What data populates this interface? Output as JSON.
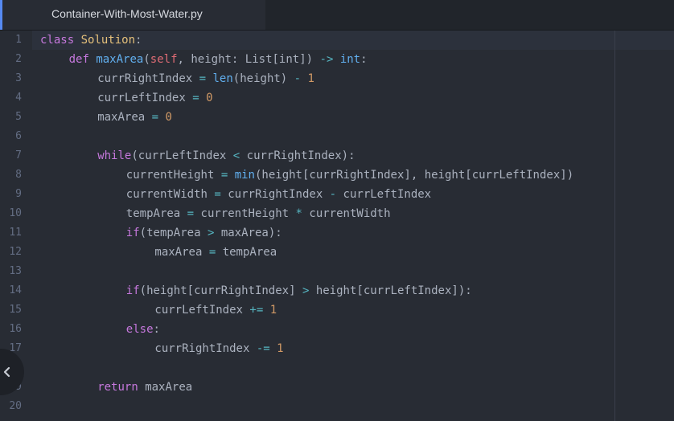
{
  "tab": {
    "title": "Container-With-Most-Water.py"
  },
  "colors": {
    "background": "#282c34",
    "keyword": "#c678dd",
    "function": "#61afef",
    "class": "#e5c07b",
    "number": "#d19a66",
    "operator": "#56b6c2",
    "self": "#e06c75",
    "plain": "#abb2bf",
    "line_number": "#636d83",
    "tab_accent": "#568af2"
  },
  "nav": {
    "icon": "chevron-left-icon"
  },
  "line_numbers": [
    "1",
    "2",
    "3",
    "4",
    "5",
    "6",
    "7",
    "8",
    "9",
    "10",
    "11",
    "12",
    "13",
    "14",
    "15",
    "16",
    "17",
    "",
    "19",
    "20"
  ],
  "code_lines": [
    {
      "num": "1",
      "indent": 0,
      "tokens": [
        {
          "t": "class",
          "c": "keyword"
        },
        {
          "t": " ",
          "c": "plain"
        },
        {
          "t": "Solution",
          "c": "class"
        },
        {
          "t": ":",
          "c": "plain"
        }
      ]
    },
    {
      "num": "2",
      "indent": 1,
      "tokens": [
        {
          "t": "def",
          "c": "keyword"
        },
        {
          "t": " ",
          "c": "plain"
        },
        {
          "t": "maxArea",
          "c": "function"
        },
        {
          "t": "(",
          "c": "plain"
        },
        {
          "t": "self",
          "c": "self"
        },
        {
          "t": ", height: List[int]) ",
          "c": "plain"
        },
        {
          "t": "->",
          "c": "operator"
        },
        {
          "t": " ",
          "c": "plain"
        },
        {
          "t": "int",
          "c": "function"
        },
        {
          "t": ":",
          "c": "plain"
        }
      ]
    },
    {
      "num": "3",
      "indent": 2,
      "tokens": [
        {
          "t": "currRightIndex ",
          "c": "plain"
        },
        {
          "t": "=",
          "c": "operator"
        },
        {
          "t": " ",
          "c": "plain"
        },
        {
          "t": "len",
          "c": "function"
        },
        {
          "t": "(height) ",
          "c": "plain"
        },
        {
          "t": "-",
          "c": "operator"
        },
        {
          "t": " ",
          "c": "plain"
        },
        {
          "t": "1",
          "c": "number"
        }
      ]
    },
    {
      "num": "4",
      "indent": 2,
      "tokens": [
        {
          "t": "currLeftIndex ",
          "c": "plain"
        },
        {
          "t": "=",
          "c": "operator"
        },
        {
          "t": " ",
          "c": "plain"
        },
        {
          "t": "0",
          "c": "number"
        }
      ]
    },
    {
      "num": "5",
      "indent": 2,
      "tokens": [
        {
          "t": "maxArea ",
          "c": "plain"
        },
        {
          "t": "=",
          "c": "operator"
        },
        {
          "t": " ",
          "c": "plain"
        },
        {
          "t": "0",
          "c": "number"
        }
      ]
    },
    {
      "num": "6",
      "indent": 0,
      "tokens": []
    },
    {
      "num": "7",
      "indent": 2,
      "tokens": [
        {
          "t": "while",
          "c": "keyword"
        },
        {
          "t": "(currLeftIndex ",
          "c": "plain"
        },
        {
          "t": "<",
          "c": "operator"
        },
        {
          "t": " currRightIndex):",
          "c": "plain"
        }
      ]
    },
    {
      "num": "8",
      "indent": 3,
      "tokens": [
        {
          "t": "currentHeight ",
          "c": "plain"
        },
        {
          "t": "=",
          "c": "operator"
        },
        {
          "t": " ",
          "c": "plain"
        },
        {
          "t": "min",
          "c": "function"
        },
        {
          "t": "(height[currRightIndex], height[currLeftIndex])",
          "c": "plain"
        }
      ]
    },
    {
      "num": "9",
      "indent": 3,
      "tokens": [
        {
          "t": "currentWidth ",
          "c": "plain"
        },
        {
          "t": "=",
          "c": "operator"
        },
        {
          "t": " currRightIndex ",
          "c": "plain"
        },
        {
          "t": "-",
          "c": "operator"
        },
        {
          "t": " currLeftIndex",
          "c": "plain"
        }
      ]
    },
    {
      "num": "10",
      "indent": 3,
      "tokens": [
        {
          "t": "tempArea ",
          "c": "plain"
        },
        {
          "t": "=",
          "c": "operator"
        },
        {
          "t": " currentHeight ",
          "c": "plain"
        },
        {
          "t": "*",
          "c": "operator"
        },
        {
          "t": " currentWidth",
          "c": "plain"
        }
      ]
    },
    {
      "num": "11",
      "indent": 3,
      "tokens": [
        {
          "t": "if",
          "c": "keyword"
        },
        {
          "t": "(tempArea ",
          "c": "plain"
        },
        {
          "t": ">",
          "c": "operator"
        },
        {
          "t": " maxArea):",
          "c": "plain"
        }
      ]
    },
    {
      "num": "12",
      "indent": 4,
      "tokens": [
        {
          "t": "maxArea ",
          "c": "plain"
        },
        {
          "t": "=",
          "c": "operator"
        },
        {
          "t": " tempArea",
          "c": "plain"
        }
      ]
    },
    {
      "num": "13",
      "indent": 0,
      "tokens": []
    },
    {
      "num": "14",
      "indent": 3,
      "tokens": [
        {
          "t": "if",
          "c": "keyword"
        },
        {
          "t": "(height[currRightIndex] ",
          "c": "plain"
        },
        {
          "t": ">",
          "c": "operator"
        },
        {
          "t": " height[currLeftIndex]):",
          "c": "plain"
        }
      ]
    },
    {
      "num": "15",
      "indent": 4,
      "tokens": [
        {
          "t": "currLeftIndex ",
          "c": "plain"
        },
        {
          "t": "+=",
          "c": "operator"
        },
        {
          "t": " ",
          "c": "plain"
        },
        {
          "t": "1",
          "c": "number"
        }
      ]
    },
    {
      "num": "16",
      "indent": 3,
      "tokens": [
        {
          "t": "else",
          "c": "keyword"
        },
        {
          "t": ":",
          "c": "plain"
        }
      ]
    },
    {
      "num": "17",
      "indent": 4,
      "tokens": [
        {
          "t": "currRightIndex ",
          "c": "plain"
        },
        {
          "t": "-=",
          "c": "operator"
        },
        {
          "t": " ",
          "c": "plain"
        },
        {
          "t": "1",
          "c": "number"
        }
      ]
    },
    {
      "num": "",
      "indent": 0,
      "tokens": []
    },
    {
      "num": "19",
      "indent": 2,
      "tokens": [
        {
          "t": "return",
          "c": "keyword"
        },
        {
          "t": " maxArea",
          "c": "plain"
        }
      ]
    },
    {
      "num": "20",
      "indent": 0,
      "tokens": []
    }
  ]
}
